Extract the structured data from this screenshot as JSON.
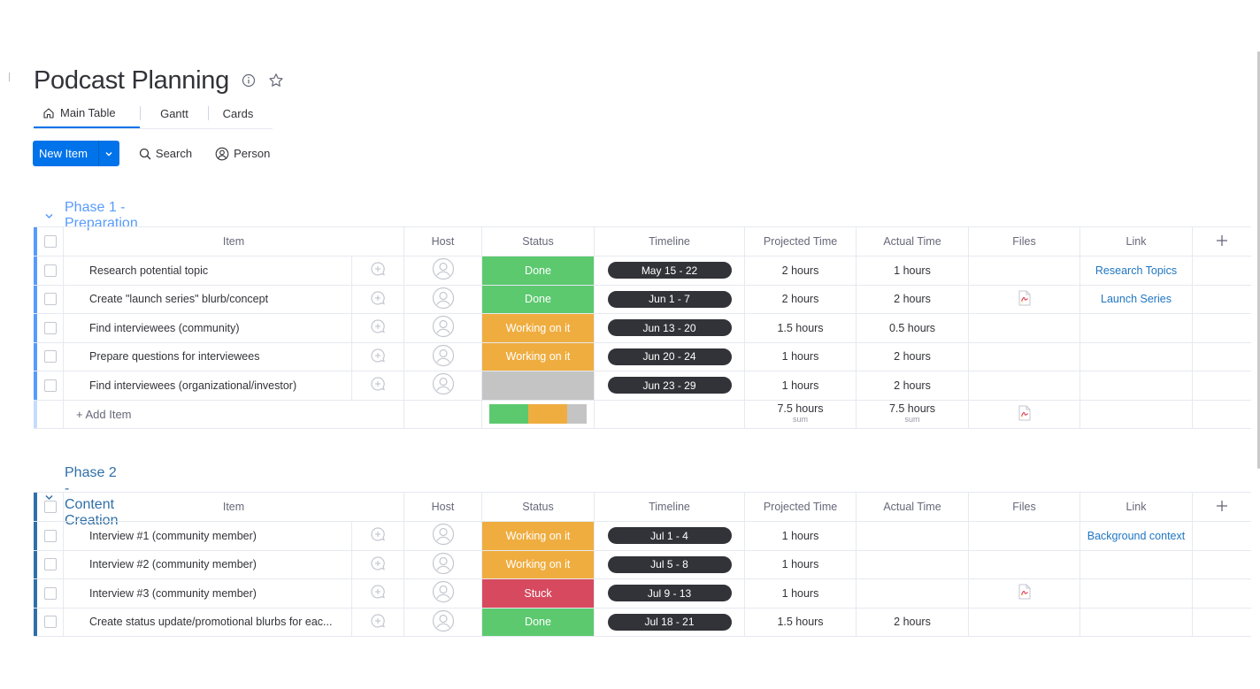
{
  "board": {
    "title": "Podcast Planning",
    "info_icon": "info-icon",
    "favorite_icon": "star-icon"
  },
  "tabs": [
    {
      "label": "Main Table",
      "icon": "home-icon",
      "active": true
    },
    {
      "label": "Gantt"
    },
    {
      "label": "Cards"
    }
  ],
  "toolbar": {
    "new_item": "New Item",
    "search": "Search",
    "person": "Person"
  },
  "colors": {
    "done": "#5cc96f",
    "working": "#efad40",
    "stuck": "#d6495e",
    "empty": "#c4c4c4",
    "timeline": "#323338",
    "accent": "#0073ea",
    "group1": "#579bfc",
    "group2": "#2f6fa8"
  },
  "columns": [
    "Item",
    "Host",
    "Status",
    "Timeline",
    "Projected Time",
    "Actual Time",
    "Files",
    "Link"
  ],
  "groups": [
    {
      "title": "Phase 1 - Preparation",
      "add_item": "+ Add Item",
      "rows": [
        {
          "item": "Research potential topic",
          "status": "Done",
          "status_color": "#5cc96f",
          "timeline": "May 15 - 22",
          "projected": "2 hours",
          "actual": "1 hours",
          "file": false,
          "link": "Research Topics"
        },
        {
          "item": "Create \"launch series\" blurb/concept",
          "status": "Done",
          "status_color": "#5cc96f",
          "timeline": "Jun 1 - 7",
          "projected": "2 hours",
          "actual": "2 hours",
          "file": true,
          "link": "Launch Series"
        },
        {
          "item": "Find interviewees (community)",
          "status": "Working on it",
          "status_color": "#efad40",
          "timeline": "Jun 13 - 20",
          "projected": "1.5 hours",
          "actual": "0.5 hours",
          "file": false,
          "link": ""
        },
        {
          "item": "Prepare questions for interviewees",
          "status": "Working on it",
          "status_color": "#efad40",
          "timeline": "Jun 20 - 24",
          "projected": "1 hours",
          "actual": "2 hours",
          "file": false,
          "link": ""
        },
        {
          "item": "Find interviewees (organizational/investor)",
          "status": "",
          "status_color": "#c4c4c4",
          "timeline": "Jun 23 - 29",
          "projected": "1 hours",
          "actual": "2 hours",
          "file": false,
          "link": ""
        }
      ],
      "summary": {
        "status_mix": [
          {
            "color": "#5cc96f",
            "share": 0.4
          },
          {
            "color": "#efad40",
            "share": 0.4
          },
          {
            "color": "#c4c4c4",
            "share": 0.2
          }
        ],
        "projected": "7.5 hours",
        "actual": "7.5 hours",
        "sum_label": "sum",
        "file": true
      }
    },
    {
      "title": "Phase 2 - Content Creation",
      "rows": [
        {
          "item": "Interview #1 (community member)",
          "status": "Working on it",
          "status_color": "#efad40",
          "timeline": "Jul 1 - 4",
          "projected": "1 hours",
          "actual": "",
          "file": false,
          "link": "Background context"
        },
        {
          "item": "Interview #2 (community member)",
          "status": "Working on it",
          "status_color": "#efad40",
          "timeline": "Jul 5 - 8",
          "projected": "1 hours",
          "actual": "",
          "file": false,
          "link": ""
        },
        {
          "item": "Interview #3 (community member)",
          "status": "Stuck",
          "status_color": "#d6495e",
          "timeline": "Jul 9 - 13",
          "projected": "1 hours",
          "actual": "",
          "file": true,
          "link": ""
        },
        {
          "item": "Create status update/promotional blurbs for eac...",
          "status": "Done",
          "status_color": "#5cc96f",
          "timeline": "Jul 18 - 21",
          "projected": "1.5 hours",
          "actual": "2 hours",
          "file": false,
          "link": ""
        }
      ]
    }
  ]
}
